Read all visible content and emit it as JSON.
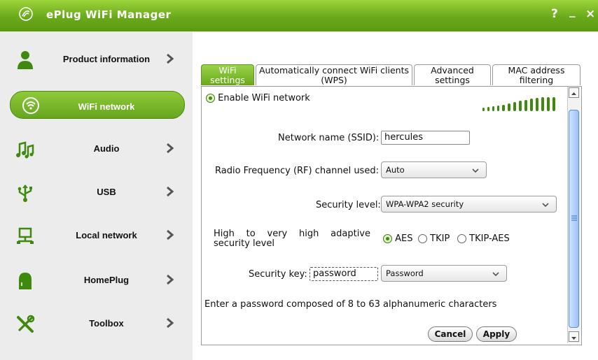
{
  "window": {
    "title": "ePlug WiFi Manager",
    "help": "?",
    "minimize": "_",
    "close": "×"
  },
  "sidebar": {
    "items": [
      {
        "label": "Product information",
        "icon": "person-icon"
      },
      {
        "label": "WiFi network",
        "icon": "wifi-icon",
        "active": true
      },
      {
        "label": "Audio",
        "icon": "music-notes-icon"
      },
      {
        "label": "USB",
        "icon": "usb-icon"
      },
      {
        "label": "Local network",
        "icon": "computer-network-icon"
      },
      {
        "label": "HomePlug",
        "icon": "homeplug-device-icon"
      },
      {
        "label": "Toolbox",
        "icon": "tools-icon"
      }
    ]
  },
  "tabs": [
    {
      "label": "WiFi settings",
      "active": true
    },
    {
      "label": "Automatically connect WiFi clients (WPS)"
    },
    {
      "label": "Advanced settings"
    },
    {
      "label": "MAC address filtering"
    }
  ],
  "form": {
    "enable_label": "Enable WiFi network",
    "ssid_label": "Network name (SSID):",
    "ssid_value": "hercules",
    "channel_label": "Radio Frequency (RF) channel used:",
    "channel_value": "Auto",
    "security_label": "Security level:",
    "security_value": "WPA-WPA2 security",
    "adaptive_label": "High to very high adaptive security level",
    "adaptive_options": [
      "AES",
      "TKIP",
      "TKIP-AES"
    ],
    "key_label": "Security key:",
    "key_value": "password",
    "key_mode": "Password",
    "hint": "Enter a password composed of 8 to 63 alphanumeric characters",
    "cancel": "Cancel",
    "apply": "Apply"
  },
  "colors": {
    "brand_green": "#6aa91a",
    "accent_blue": "#5a8fd8"
  }
}
